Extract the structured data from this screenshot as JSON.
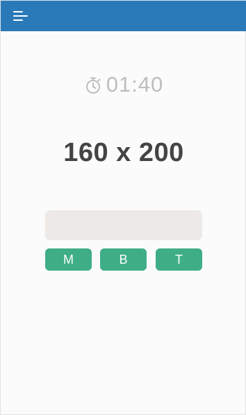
{
  "timer": {
    "text": "01:40"
  },
  "question": {
    "text": "160 x 200"
  },
  "answer": {
    "value": "",
    "placeholder": ""
  },
  "choices": [
    {
      "label": "M"
    },
    {
      "label": "B"
    },
    {
      "label": "T"
    }
  ],
  "colors": {
    "appbar": "#2a7ab9",
    "choice_button": "#3fae86",
    "input_background": "#ece9e7",
    "question_text": "#444444",
    "timer_text": "#bdbdbd"
  },
  "icons": {
    "menu": "menu-icon",
    "timer": "stopwatch-icon"
  }
}
